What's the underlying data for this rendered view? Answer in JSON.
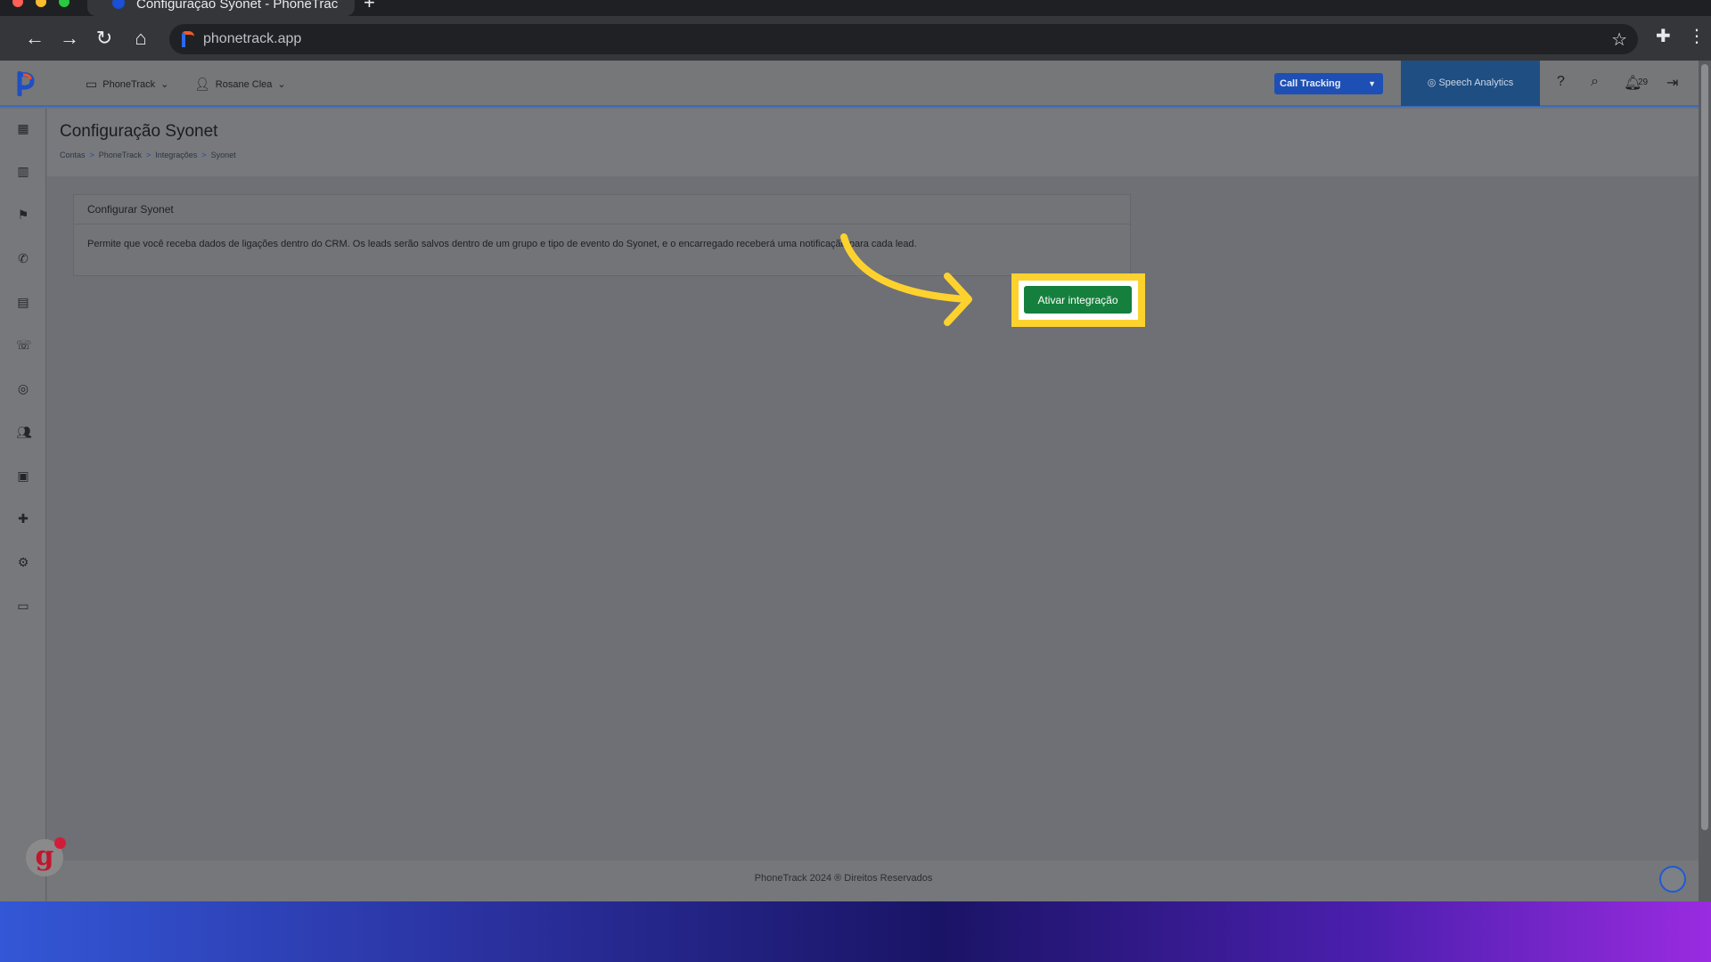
{
  "browser": {
    "tab_title": "Configuração Syonet - PhoneTrac",
    "url": "phonetrack.app"
  },
  "header": {
    "account_menu": "PhoneTrack",
    "user_menu": "Rosane Clea",
    "product_select": "Call Tracking",
    "speech_analytics": "Speech Analytics",
    "notifications_count": "29"
  },
  "page": {
    "title": "Configuração Syonet",
    "breadcrumb": [
      "Contas",
      "PhoneTrack",
      "Integrações",
      "Syonet"
    ]
  },
  "card": {
    "title": "Configurar Syonet",
    "description": "Permite que você receba dados de ligações dentro do CRM. Os leads serão salvos dentro de um grupo e tipo de evento do Syonet, e o encarregado receberá uma notificação para cada lead."
  },
  "actions": {
    "activate_label": "Ativar integração"
  },
  "footer": {
    "copyright": "PhoneTrack 2024 ® Direitos Reservados"
  },
  "colors": {
    "primary_blue": "#1e4fb4",
    "success_green": "#15803d",
    "highlight_yellow": "#fdd22e"
  }
}
